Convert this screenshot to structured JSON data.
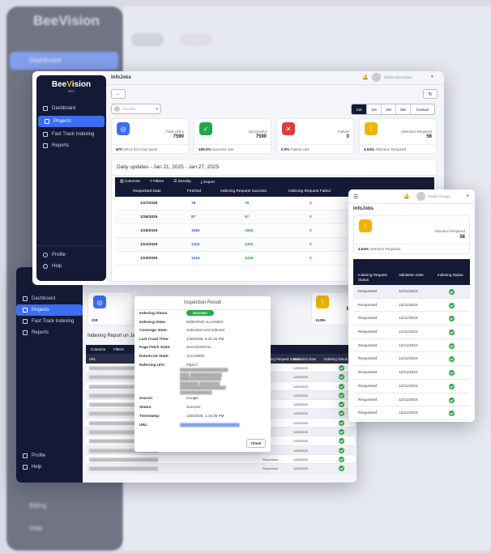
{
  "brand": {
    "name_a": "Bee",
    "name_b": "Vision",
    "sub": "SEO"
  },
  "bg": {
    "nav": [
      "Dashboard",
      "Projects",
      "Fast Track Indexing",
      "Reports"
    ],
    "bottom": [
      "Billing",
      "Help"
    ]
  },
  "main_window": {
    "title": "InfoJobs",
    "user": "Dmitrii Bermudez",
    "sidebar": [
      "Dashboard",
      "Projects",
      "Fast Track Indexing",
      "Reports"
    ],
    "sidebar_bottom": [
      "Profile",
      "Help"
    ],
    "select_placeholder": "InfoJobs",
    "ranges": [
      "1W",
      "1M",
      "2M",
      "6M",
      "Custom"
    ],
    "cards": [
      {
        "label": "Total URLs",
        "value": "7590",
        "foot_value": "570",
        "foot_label": "URLs from last week",
        "color": "#3d6df2"
      },
      {
        "label": "Successful",
        "value": "7590",
        "foot_value": "100.0%",
        "foot_label": "Success rate",
        "color": "#1ea84a"
      },
      {
        "label": "Failure",
        "value": "0",
        "foot_value": "0.0%",
        "foot_label": "Failure rate",
        "color": "#e23b3b"
      },
      {
        "label": "Attention Required",
        "value": "56",
        "foot_value": "4.04%",
        "foot_label": "Attention Required",
        "color": "#f0b400"
      }
    ],
    "daily_title": "Daily updates - Jan 21, 2025 - Jan 27, 2025",
    "toolbar": [
      "Columns",
      "Filters",
      "Density",
      "Export"
    ],
    "columns": [
      "Requested Date",
      "Fetched",
      "Indexing Request Success",
      "Indexing Request Failed"
    ],
    "rows": [
      [
        "1/27/2025",
        "78",
        "78",
        "0"
      ],
      [
        "1/26/2025",
        "97",
        "97",
        "0"
      ],
      [
        "1/25/2025",
        "1562",
        "1562",
        "0"
      ],
      [
        "1/24/2025",
        "1302",
        "1302",
        "0"
      ],
      [
        "1/23/2025",
        "1416",
        "1416",
        "0"
      ]
    ]
  },
  "report_window": {
    "sidebar": [
      "Dashboard",
      "Projects",
      "Fast Track Indexing",
      "Reports"
    ],
    "sidebar_bottom": [
      "Profile",
      "Help"
    ],
    "card_stat_left": "219",
    "card_stat_right_value": "8",
    "card_stat_right_pct": "13.8%",
    "report_title": "Indexing Report on Jan 27, 2025",
    "toolbar": [
      "Columns",
      "Filters"
    ],
    "columns": [
      "URL",
      "Indexing Request Status",
      "Validation Date",
      "Indexing Status"
    ],
    "validation_dates": [
      "1/30/2025",
      "1/30/2025",
      "1/30/2025",
      "1/30/2025",
      "1/30/2025",
      "1/30/2025",
      "1/30/2025",
      "1/30/2025",
      "1/30/2025",
      "1/30/2025",
      "1/30/2025",
      "1/30/2025"
    ],
    "row_status": [
      "Requested",
      "Requested"
    ]
  },
  "modal": {
    "title": "Inspection Result",
    "fields": [
      {
        "k": "Indexing Status:",
        "v": "Success"
      },
      {
        "k": "Indexing State:",
        "v": "INDEXING ALLOWED"
      },
      {
        "k": "Coverage State:",
        "v": "Submitted and indexed"
      },
      {
        "k": "Last Crawl Time:",
        "v": "1/30/2025, 5:31:22 PM"
      },
      {
        "k": "Page Fetch State:",
        "v": "SUCCESSFUL"
      },
      {
        "k": "Robots.txt State:",
        "v": "ALLOWED"
      },
      {
        "k": "Referring Urls:",
        "v": "https://"
      }
    ],
    "fields2": [
      {
        "k": "Source:",
        "v": "Google"
      },
      {
        "k": "Status:",
        "v": "Success"
      },
      {
        "k": "Timestamp:",
        "v": "1/30/2025, 1:16:35 PM"
      },
      {
        "k": "URL:",
        "v": ""
      }
    ],
    "close": "Close"
  },
  "mobile": {
    "title": "InfoJobs",
    "user": "Dustin Dunge",
    "card_label": "Attention Required",
    "card_value": "56",
    "card_foot_value": "4.04%",
    "card_foot_label": "Attention Required",
    "columns": [
      "Indexing Request Status",
      "Validation Date",
      "Indexing Status"
    ],
    "rows": [
      [
        "Requested",
        "12/11/2024"
      ],
      [
        "Requested",
        "12/11/2024"
      ],
      [
        "Requested",
        "12/11/2024"
      ],
      [
        "Requested",
        "12/11/2024"
      ],
      [
        "Requested",
        "12/11/2024"
      ],
      [
        "Requested",
        "12/11/2024"
      ],
      [
        "Requested",
        "12/11/2024"
      ],
      [
        "Requested",
        "12/11/2024"
      ],
      [
        "Requested",
        "12/11/2024"
      ],
      [
        "Requested",
        "12/11/2024"
      ],
      [
        "Requested",
        "12/11/2024"
      ]
    ]
  }
}
